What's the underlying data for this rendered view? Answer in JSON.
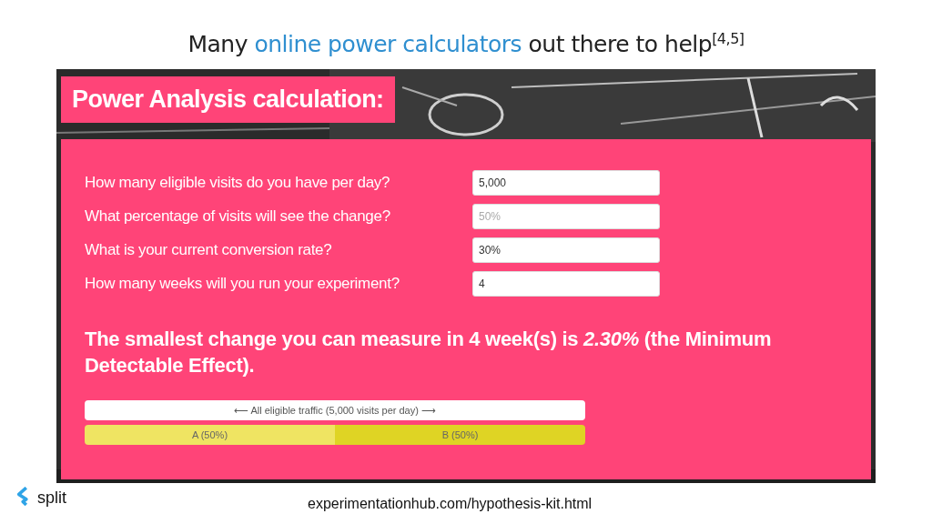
{
  "slide_title": {
    "before": "Many ",
    "link": "online power calculators",
    "after": " out there to help$^{[4,5]}$"
  },
  "calculator": {
    "heading": "Power Analysis calculation:",
    "fields": [
      {
        "label": "How many eligible visits do you have per day?",
        "value": "5,000"
      },
      {
        "label": "What percentage of visits will see the change?",
        "placeholder": "50%"
      },
      {
        "label": "What is your current conversion rate?",
        "value": "30%"
      },
      {
        "label": "How many weeks will you run your experiment?",
        "value": "4"
      }
    ],
    "result": "The smallest change you can measure in 4 week(s) is *2.30%* (the Minimum Detectable Effect).",
    "traffic_bar": "⟵ All eligible traffic (5,000 visits per day) ⟶",
    "split": [
      {
        "label": "A (50%)",
        "color": "#efe462"
      },
      {
        "label": "B (50%)",
        "color": "#dfd424"
      }
    ]
  },
  "logo": "split",
  "source": "experimentationhub.com/hypothesis-kit.html"
}
